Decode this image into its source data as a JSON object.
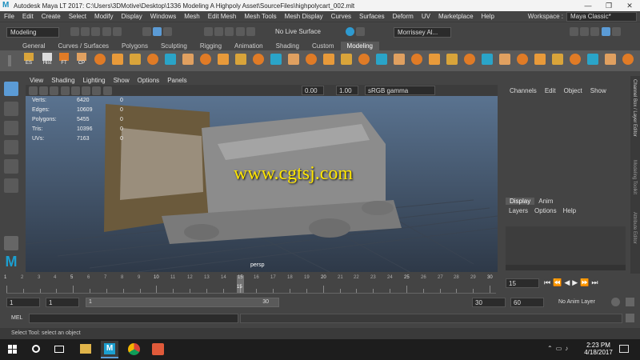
{
  "window": {
    "title": "Autodesk Maya LT 2017: C:\\Users\\3DMotive\\Desktop\\1336 Modeling A Highpoly Asset\\SourceFiles\\highpolycart_002.mlt",
    "minimize": "—",
    "maximize": "❐",
    "close": "✕"
  },
  "menubar": [
    "File",
    "Edit",
    "Create",
    "Select",
    "Modify",
    "Display",
    "Windows",
    "Mesh",
    "Edit Mesh",
    "Mesh Tools",
    "Mesh Display",
    "Curves",
    "Surfaces",
    "Deform",
    "UV",
    "Marketplace",
    "Help"
  ],
  "workspace": {
    "label": "Workspace :",
    "value": "Maya Classic*"
  },
  "status": {
    "mode": "Modeling",
    "live_surface": "No Live Surface",
    "user": "Morrissey Al..."
  },
  "shelf_tabs": [
    "General",
    "Curves / Surfaces",
    "Polygons",
    "Sculpting",
    "Rigging",
    "Animation",
    "Shading",
    "Custom",
    "Modeling"
  ],
  "shelf_active": "Modeling",
  "shelf_labels": [
    "ES",
    "Hist",
    "FT",
    "CP"
  ],
  "viewport_menu": [
    "View",
    "Shading",
    "Lighting",
    "Show",
    "Options",
    "Panels"
  ],
  "viewport_toolbar": {
    "value1": "0.00",
    "value2": "1.00",
    "colorspace": "sRGB gamma"
  },
  "hud": [
    {
      "label": "Verts:",
      "value": "6420",
      "zero": "0"
    },
    {
      "label": "Edges:",
      "value": "10609",
      "zero": "0"
    },
    {
      "label": "Polygons:",
      "value": "5455",
      "zero": "0"
    },
    {
      "label": "Tris:",
      "value": "10396",
      "zero": "0"
    },
    {
      "label": "UVs:",
      "value": "7163",
      "zero": "0"
    }
  ],
  "camera_label": "persp",
  "watermark": "www.cgtsj.com",
  "channel_menu": [
    "Channels",
    "Edit",
    "Object",
    "Show"
  ],
  "layer_tabs": [
    "Display",
    "Anim"
  ],
  "layer_menu": [
    "Layers",
    "Options",
    "Help"
  ],
  "right_sidebar": [
    "Channel Box / Layer Editor",
    "Modeling Toolkit",
    "Attribute Editor"
  ],
  "timeline": {
    "ticks": [
      "1",
      "5",
      "10",
      "15",
      "20",
      "25",
      "30"
    ],
    "ticks_small": [
      "2",
      "3",
      "4",
      "6",
      "7",
      "8",
      "9",
      "11",
      "12",
      "13",
      "14",
      "16",
      "17",
      "18",
      "19",
      "21",
      "22",
      "23",
      "24",
      "26",
      "27",
      "28",
      "29"
    ],
    "current_frame": "15",
    "playhead_label": "15"
  },
  "range": {
    "start_outer": "1",
    "start_inner": "1",
    "slider_start": "1",
    "slider_end": "30",
    "end_inner": "30",
    "end_outer": "60",
    "anim_layer": "No Anim Layer"
  },
  "cmdline": {
    "label": "MEL"
  },
  "help_line": "Select Tool: select an object",
  "taskbar": {
    "time": "2:23 PM",
    "date": "4/18/2017"
  },
  "colors": {
    "accent": "#5b9bd5",
    "shelf_icon": "#e07b26",
    "viewport_top": "#5a7390",
    "viewport_bottom": "#2e3948",
    "watermark": "#ffe600"
  }
}
